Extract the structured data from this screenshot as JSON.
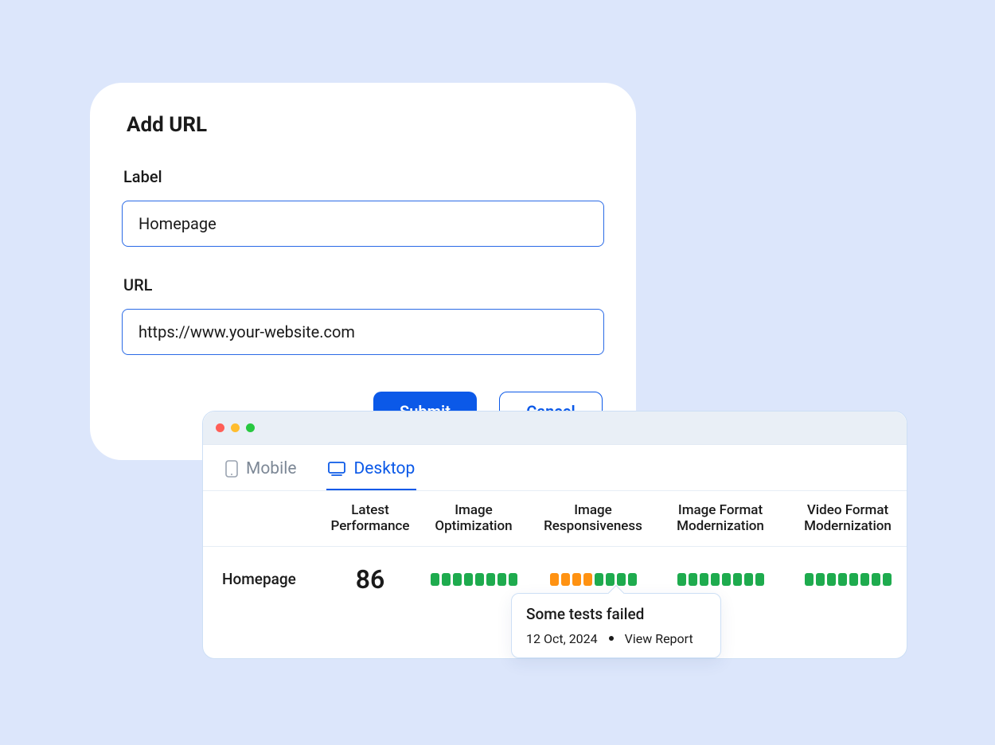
{
  "addUrl": {
    "title": "Add URL",
    "labelField": {
      "label": "Label",
      "value": "Homepage"
    },
    "urlField": {
      "label": "URL",
      "value": "https://www.your-website.com"
    },
    "submit": "Submit",
    "cancel": "Cancel"
  },
  "report": {
    "tabs": {
      "mobile": "Mobile",
      "desktop": "Desktop",
      "active": "desktop"
    },
    "columns": [
      "",
      "Latest Performance",
      "Image Optimization",
      "Image Responsiveness",
      "Image Format Modernization",
      "Video Format Modernization"
    ],
    "row": {
      "name": "Homepage",
      "performance": "86",
      "metrics": {
        "imageOptimization": [
          "green",
          "green",
          "green",
          "green",
          "green",
          "green",
          "green",
          "green"
        ],
        "imageResponsiveness": [
          "orange",
          "orange",
          "orange",
          "orange",
          "green",
          "green",
          "green",
          "green"
        ],
        "imageFormatModernization": [
          "green",
          "green",
          "green",
          "green",
          "green",
          "green",
          "green",
          "green"
        ],
        "videoFormatModernization": [
          "green",
          "green",
          "green",
          "green",
          "green",
          "green",
          "green",
          "green"
        ]
      }
    },
    "popover": {
      "title": "Some tests failed",
      "date": "12 Oct, 2024",
      "action": "View Report"
    }
  },
  "colors": {
    "accent": "#0b59e8",
    "green": "#1eab4e",
    "orange": "#ff9212"
  }
}
